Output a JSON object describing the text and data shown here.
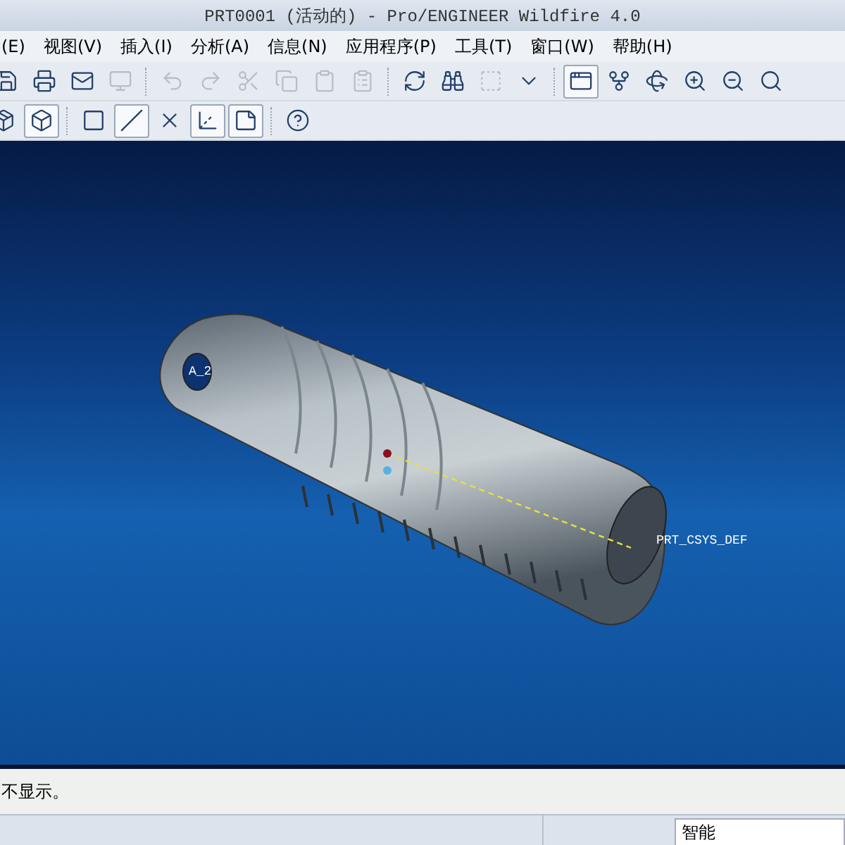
{
  "window": {
    "title": "PRT0001 (活动的) - Pro/ENGINEER Wildfire 4.0"
  },
  "menu": [
    "(E)",
    "视图(V)",
    "插入(I)",
    "分析(A)",
    "信息(N)",
    "应用程序(P)",
    "工具(T)",
    "窗口(W)",
    "帮助(H)"
  ],
  "toolbar_1": [
    {
      "selected": false,
      "disabled": false
    },
    {
      "selected": false,
      "disabled": false
    },
    {
      "selected": false,
      "disabled": false
    },
    {
      "selected": false,
      "disabled": true
    },
    {
      "selected": false,
      "disabled": true
    },
    {
      "selected": false,
      "disabled": true
    },
    {
      "selected": false,
      "disabled": true
    },
    {
      "selected": false,
      "disabled": true
    },
    {
      "selected": false,
      "disabled": true
    },
    {
      "selected": false,
      "disabled": true
    },
    {
      "selected": false,
      "disabled": false
    },
    {
      "selected": false,
      "disabled": false
    },
    {
      "selected": false,
      "disabled": true
    },
    {
      "selected": false,
      "disabled": false
    },
    {
      "selected": true,
      "disabled": false
    },
    {
      "selected": false,
      "disabled": false
    },
    {
      "selected": false,
      "disabled": false
    },
    {
      "selected": false,
      "disabled": false
    },
    {
      "selected": false,
      "disabled": false
    },
    {
      "selected": false,
      "disabled": false
    }
  ],
  "toolbar_2": [
    {
      "selected": false,
      "disabled": false
    },
    {
      "selected": true,
      "disabled": false
    },
    {
      "selected": false,
      "disabled": false
    },
    {
      "selected": true,
      "disabled": false
    },
    {
      "selected": false,
      "disabled": false
    },
    {
      "selected": true,
      "disabled": false
    },
    {
      "selected": true,
      "disabled": false
    },
    {
      "selected": false,
      "disabled": false
    }
  ],
  "viewport": {
    "labels": [
      "A_2",
      "PRT_CSYS_DEF"
    ]
  },
  "message": "不显示。",
  "status_bar": {
    "filter": "智能"
  }
}
